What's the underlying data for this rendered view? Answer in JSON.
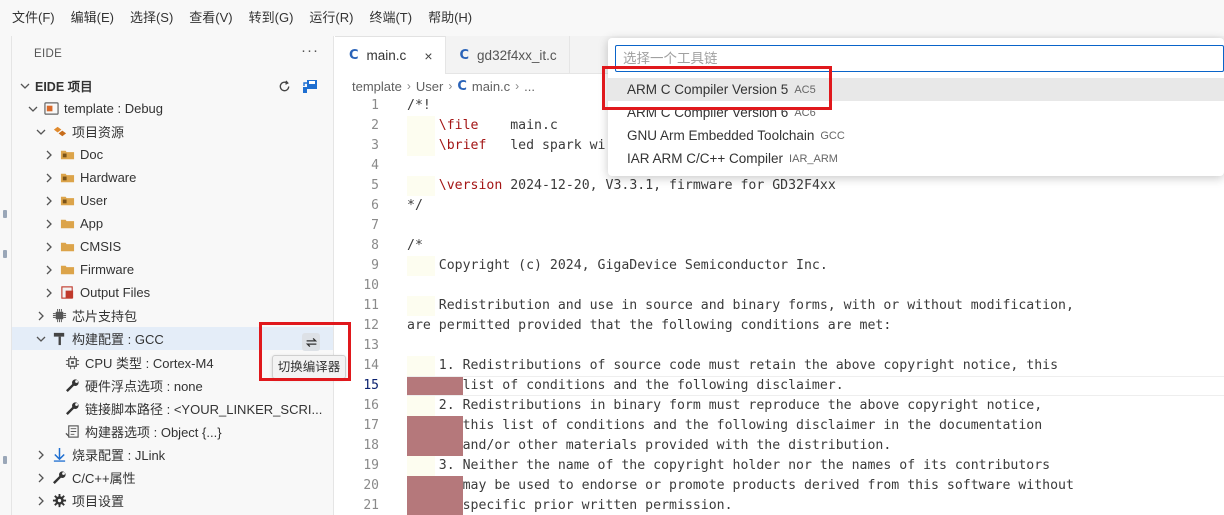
{
  "menu": [
    "文件(F)",
    "编辑(E)",
    "选择(S)",
    "查看(V)",
    "转到(G)",
    "运行(R)",
    "终端(T)",
    "帮助(H)"
  ],
  "sidebar": {
    "title": "EIDE",
    "more": "···",
    "project_section": "EIDE 项目",
    "target": "template : Debug",
    "resources": "项目资源",
    "folders": [
      "Doc",
      "Hardware",
      "User",
      "App",
      "CMSIS",
      "Firmware",
      "Output Files"
    ],
    "chip_pack": "芯片支持包",
    "build_config": "构建配置 : GCC",
    "cpu_type": "CPU 类型 : Cortex-M4",
    "fpu": "硬件浮点选项 : none",
    "linker": "链接脚本路径 : <YOUR_LINKER_SCRI...",
    "builder_options": "构建器选项 : Object {...}",
    "flash_config": "烧录配置 : JLink",
    "cpp_props": "C/C++属性",
    "project_settings": "项目设置",
    "switch_tooltip": "切换编译器"
  },
  "editor": {
    "tabs": [
      {
        "icon": "C",
        "label": "main.c",
        "close": "×"
      },
      {
        "icon": "C",
        "label": "gd32f4xx_it.c"
      }
    ],
    "breadcrumb": [
      "template",
      "User",
      "main.c",
      "..."
    ],
    "current_line": "15",
    "lines": [
      {
        "n": "1",
        "text": "/*!"
      },
      {
        "n": "2",
        "text": "    \\file    main.c"
      },
      {
        "n": "3",
        "text": "    \\brief   led spark wi"
      },
      {
        "n": "4",
        "text": ""
      },
      {
        "n": "5",
        "text": "    \\version 2024-12-20, V3.3.1, firmware for GD32F4xx"
      },
      {
        "n": "6",
        "text": "*/"
      },
      {
        "n": "7",
        "text": ""
      },
      {
        "n": "8",
        "text": "/*"
      },
      {
        "n": "9",
        "text": "    Copyright (c) 2024, GigaDevice Semiconductor Inc."
      },
      {
        "n": "10",
        "text": ""
      },
      {
        "n": "11",
        "text": "    Redistribution and use in source and binary forms, with or without modification,"
      },
      {
        "n": "12",
        "text": "are permitted provided that the following conditions are met:"
      },
      {
        "n": "13",
        "text": ""
      },
      {
        "n": "14",
        "text": "    1. Redistributions of source code must retain the above copyright notice, this"
      },
      {
        "n": "15",
        "text": "       list of conditions and the following disclaimer."
      },
      {
        "n": "16",
        "text": "    2. Redistributions in binary form must reproduce the above copyright notice,"
      },
      {
        "n": "17",
        "text": "       this list of conditions and the following disclaimer in the documentation"
      },
      {
        "n": "18",
        "text": "       and/or other materials provided with the distribution."
      },
      {
        "n": "19",
        "text": "    3. Neither the name of the copyright holder nor the names of its contributors"
      },
      {
        "n": "20",
        "text": "       may be used to endorse or promote products derived from this software without"
      },
      {
        "n": "21",
        "text": "       specific prior written permission."
      }
    ]
  },
  "quickpick": {
    "placeholder": "选择一个工具链",
    "items": [
      {
        "label": "ARM C Compiler Version 5",
        "desc": "AC5"
      },
      {
        "label": "ARM C Compiler Version 6",
        "desc": "AC6"
      },
      {
        "label": "GNU Arm Embedded Toolchain",
        "desc": "GCC"
      },
      {
        "label": "IAR ARM C/C++ Compiler",
        "desc": "IAR_ARM"
      }
    ]
  },
  "colors": {
    "accent": "#0a64c9",
    "highlight_box": "#e0181c",
    "keyword": "#a31515",
    "change_marker": "#b5787b"
  }
}
